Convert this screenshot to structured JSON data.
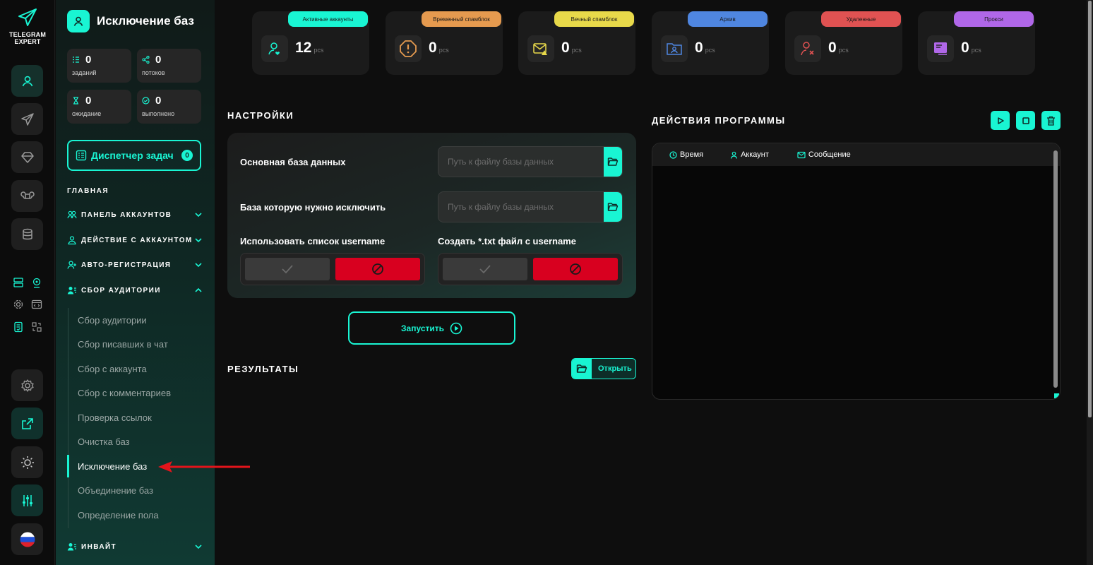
{
  "app": {
    "logo_line1": "TELEGRAM",
    "logo_line2": "EXPERT"
  },
  "sidebar": {
    "title": "Исключение баз",
    "stats": [
      {
        "value": "0",
        "label": "заданий",
        "icon": "tasks-icon"
      },
      {
        "value": "0",
        "label": "потоков",
        "icon": "threads-icon"
      },
      {
        "value": "0",
        "label": "ожидание",
        "icon": "hourglass-icon"
      },
      {
        "value": "0",
        "label": "выполнено",
        "icon": "check-circle-icon"
      }
    ],
    "task_manager": {
      "label": "Диспетчер задач",
      "count": "0"
    },
    "section": "ГЛАВНАЯ",
    "menu": [
      {
        "label": "ПАНЕЛЬ АККАУНТОВ",
        "icon": "users-icon"
      },
      {
        "label": "ДЕЙСТВИЕ С АККАУНТОМ",
        "icon": "user-icon"
      },
      {
        "label": "АВТО-РЕГИСТРАЦИЯ",
        "icon": "user-plus-icon"
      },
      {
        "label": "СБОР АУДИТОРИИ",
        "icon": "audience-icon"
      }
    ],
    "submenu": [
      "Сбор аудитории",
      "Сбор писавших в чат",
      "Сбор с аккаунта",
      "Сбор с комментариев",
      "Проверка ссылок",
      "Очистка баз",
      "Исключение баз",
      "Объединение баз",
      "Определение пола"
    ],
    "bottom_menu": {
      "label": "ИНВАЙТ",
      "icon": "invite-icon"
    }
  },
  "accounts": [
    {
      "tag": "Активные аккаунты",
      "value": "12",
      "unit": "pcs",
      "color": "#19f5d3",
      "icon": "user-heart-icon"
    },
    {
      "tag": "Временный спамблок",
      "value": "0",
      "unit": "pcs",
      "color": "#e59a4f",
      "icon": "warning-icon"
    },
    {
      "tag": "Вечный спамблок",
      "value": "0",
      "unit": "pcs",
      "color": "#e8d94a",
      "icon": "mail-warning-icon"
    },
    {
      "tag": "Архив",
      "value": "0",
      "unit": "pcs",
      "color": "#4f86e0",
      "icon": "folder-user-icon"
    },
    {
      "tag": "Удаленные",
      "value": "0",
      "unit": "pcs",
      "color": "#e05252",
      "icon": "user-x-icon"
    },
    {
      "tag": "Прокси",
      "value": "0",
      "unit": "pcs",
      "color": "#b067e8",
      "icon": "proxy-icon"
    }
  ],
  "settings": {
    "title": "НАСТРОЙКИ",
    "main_db_label": "Основная база данных",
    "main_db_placeholder": "Путь к файлу базы данных",
    "exclude_db_label": "База которую нужно исключить",
    "exclude_db_placeholder": "Путь к файлу базы данных",
    "use_username_label": "Использовать список username",
    "create_txt_label": "Создать *.txt файл с username"
  },
  "run_button": "Запустить",
  "results": {
    "title": "РЕЗУЛЬТАТЫ",
    "open_label": "Открыть"
  },
  "actions": {
    "title": "ДЕЙСТВИЯ ПРОГРАММЫ",
    "columns": [
      "Время",
      "Аккаунт",
      "Сообщение"
    ]
  }
}
